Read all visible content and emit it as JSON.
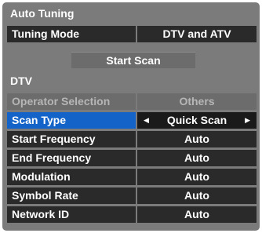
{
  "window": {
    "title": "Auto Tuning"
  },
  "tuning_mode": {
    "label": "Tuning Mode",
    "value": "DTV and ATV"
  },
  "start_scan": {
    "label": "Start Scan"
  },
  "section": {
    "title": "DTV"
  },
  "settings": [
    {
      "label": "Operator Selection",
      "value": "Others"
    },
    {
      "label": "Scan Type",
      "value": "Quick Scan"
    },
    {
      "label": "Start Frequency",
      "value": "Auto"
    },
    {
      "label": "End Frequency",
      "value": "Auto"
    },
    {
      "label": "Modulation",
      "value": "Auto"
    },
    {
      "label": "Symbol Rate",
      "value": "Auto"
    },
    {
      "label": "Network ID",
      "value": "Auto"
    }
  ],
  "colors": {
    "panel": "#7b7b7b",
    "row": "#2a2a2a",
    "selected": "#1463c8",
    "disabled": "#6c6c6c"
  }
}
